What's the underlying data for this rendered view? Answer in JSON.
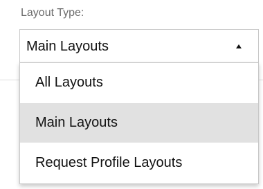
{
  "field": {
    "label": "Layout Type:",
    "selected_value": "Main Layouts",
    "arrow_icon": "triangle-up-icon"
  },
  "dropdown": {
    "options": [
      {
        "label": "All Layouts",
        "selected": false
      },
      {
        "label": "Main Layouts",
        "selected": true
      },
      {
        "label": "Request Profile Layouts",
        "selected": false
      }
    ]
  },
  "colors": {
    "selected_option_bg": "#e1e1e1",
    "label_text": "#6b6b6b",
    "border": "#c8c8c8"
  }
}
